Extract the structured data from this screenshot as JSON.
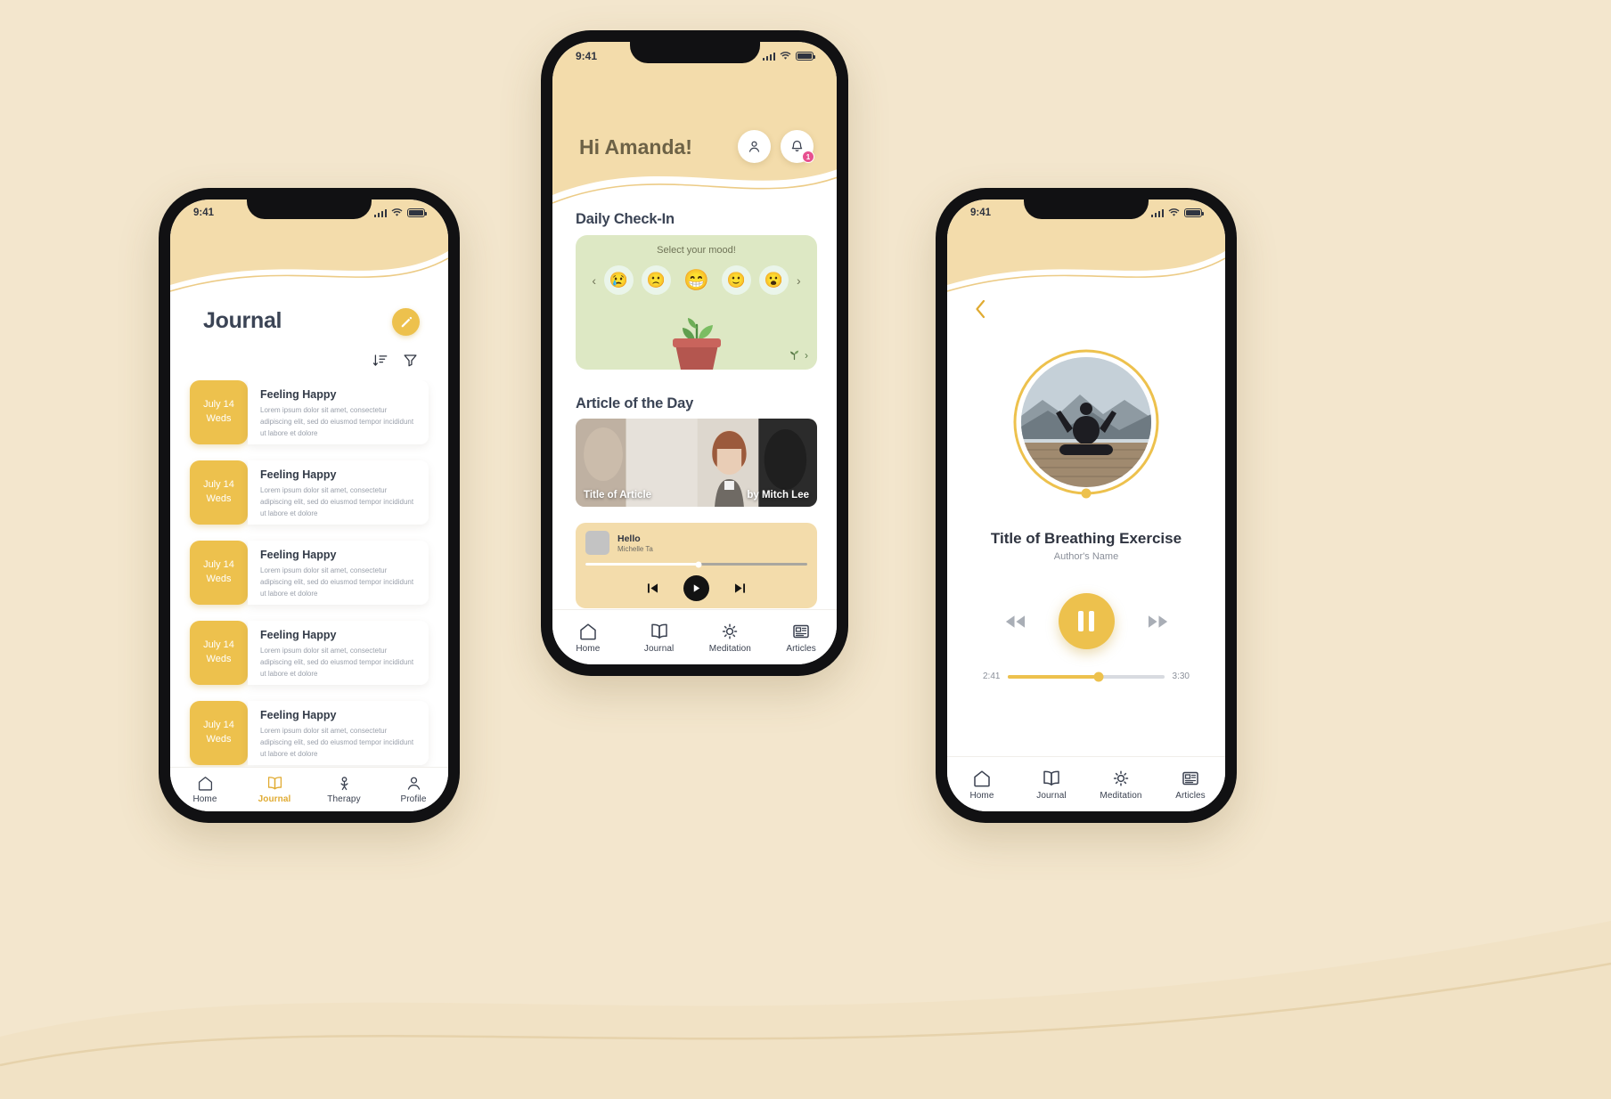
{
  "background": {
    "color": "#f3e6cd"
  },
  "theme": {
    "accent": "#edc14d",
    "dark_text": "#3b4455",
    "cream": "#f3dcab",
    "mint": "#dde8c4",
    "badge": "#e7508f"
  },
  "phone_journal": {
    "status": {
      "time": "9:41",
      "battery": "full"
    },
    "title": "Journal",
    "edit_icon": "pencil-icon",
    "sort_icon": "sort-descending-icon",
    "filter_icon": "funnel-filter-icon",
    "entries": [
      {
        "month_day": "July 14",
        "weekday": "Weds",
        "title": "Feeling Happy",
        "excerpt": "Lorem ipsum dolor sit amet, consectetur adipiscing elit, sed do eiusmod tempor incididunt ut labore et dolore"
      },
      {
        "month_day": "July 14",
        "weekday": "Weds",
        "title": "Feeling Happy",
        "excerpt": "Lorem ipsum dolor sit amet, consectetur adipiscing elit, sed do eiusmod tempor incididunt ut labore et dolore"
      },
      {
        "month_day": "July 14",
        "weekday": "Weds",
        "title": "Feeling Happy",
        "excerpt": "Lorem ipsum dolor sit amet, consectetur adipiscing elit, sed do eiusmod tempor incididunt ut labore et dolore"
      },
      {
        "month_day": "July 14",
        "weekday": "Weds",
        "title": "Feeling Happy",
        "excerpt": "Lorem ipsum dolor sit amet, consectetur adipiscing elit, sed do eiusmod tempor incididunt ut labore et dolore"
      },
      {
        "month_day": "July 14",
        "weekday": "Weds",
        "title": "Feeling Happy",
        "excerpt": "Lorem ipsum dolor sit amet, consectetur adipiscing elit, sed do eiusmod tempor incididunt ut labore et dolore"
      }
    ],
    "nav": [
      {
        "label": "Home",
        "icon": "home-icon",
        "active": false
      },
      {
        "label": "Journal",
        "icon": "open-book-icon",
        "active": true
      },
      {
        "label": "Therapy",
        "icon": "therapy-person-icon",
        "active": false
      },
      {
        "label": "Profile",
        "icon": "user-profile-icon",
        "active": false
      }
    ]
  },
  "phone_home": {
    "status": {
      "time": "9:41",
      "battery": "full"
    },
    "greeting": "Hi Amanda!",
    "profile_icon": "user-icon",
    "bell_icon": "bell-notification-icon",
    "notification_count": "1",
    "checkin": {
      "heading": "Daily Check-In",
      "prompt": "Select your mood!",
      "prev_arrow": "chevron-left-icon",
      "next_arrow": "chevron-right-icon",
      "moods": [
        "😢",
        "🙁",
        "😁",
        "🙂",
        "😮"
      ],
      "selected_index": 2,
      "plant_icon": "sprout-plant-icon",
      "plant_cta_arrow": "chevron-right-icon"
    },
    "article": {
      "heading": "Article of the Day",
      "title": "Title of Article",
      "byline": "by Mitch Lee"
    },
    "mini_player": {
      "track": "Hello",
      "artist": "Michelle Ta",
      "progress_percent": 51,
      "prev_icon": "skip-previous-icon",
      "play_icon": "play-icon",
      "next_icon": "skip-next-icon"
    },
    "nav": [
      {
        "label": "Home",
        "icon": "home-icon",
        "active": false
      },
      {
        "label": "Journal",
        "icon": "open-book-icon",
        "active": false
      },
      {
        "label": "Meditation",
        "icon": "sun-meditation-icon",
        "active": false
      },
      {
        "label": "Articles",
        "icon": "newspaper-icon",
        "active": false
      }
    ]
  },
  "phone_breathing": {
    "status": {
      "time": "9:41",
      "battery": "full"
    },
    "back_icon": "chevron-left-icon",
    "cover_icon": "yoga-meditation-photo",
    "title": "Title of Breathing Exercise",
    "author": "Author's Name",
    "controls": {
      "rewind_icon": "rewind-icon",
      "pause_icon": "pause-icon",
      "forward_icon": "fast-forward-icon"
    },
    "elapsed": "2:41",
    "duration": "3:30",
    "progress_percent": 58,
    "nav": [
      {
        "label": "Home",
        "icon": "home-icon",
        "active": false
      },
      {
        "label": "Journal",
        "icon": "open-book-icon",
        "active": false
      },
      {
        "label": "Meditation",
        "icon": "sun-meditation-icon",
        "active": false
      },
      {
        "label": "Articles",
        "icon": "newspaper-icon",
        "active": false
      }
    ]
  }
}
